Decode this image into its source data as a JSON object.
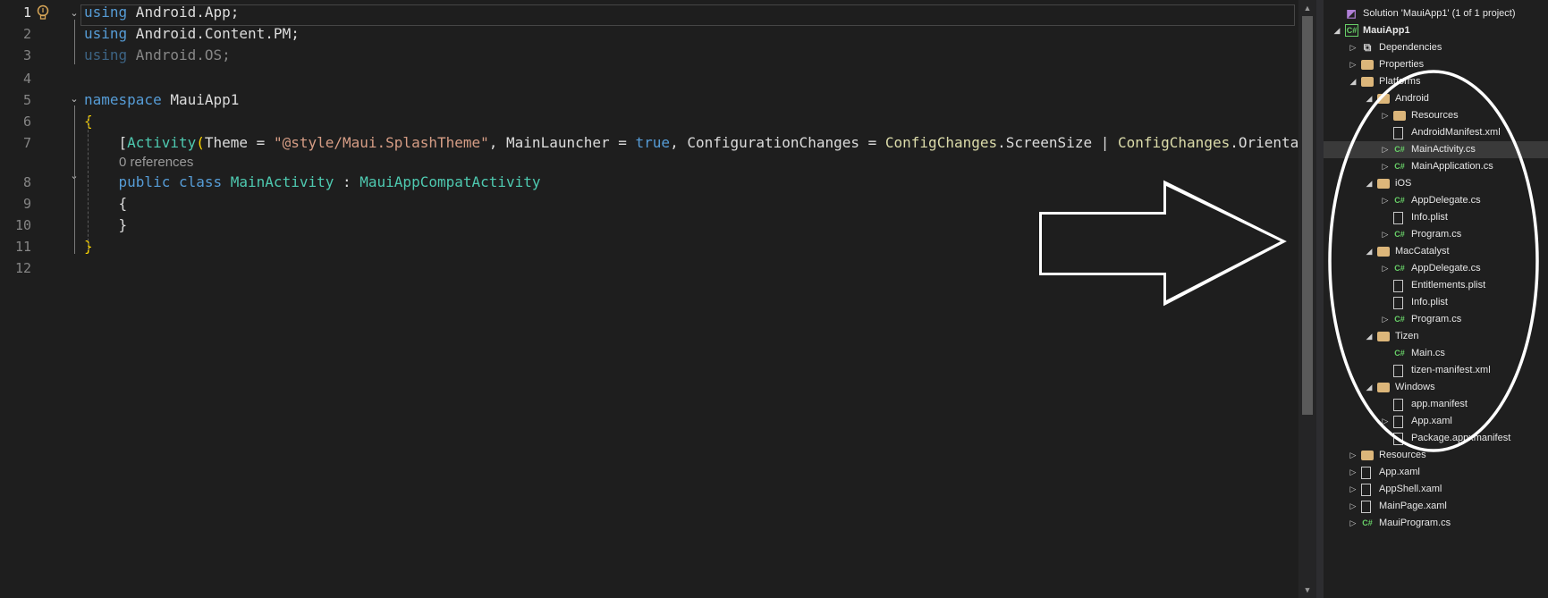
{
  "editor": {
    "lines": [
      {
        "n": "1",
        "active": true,
        "parts": [
          [
            "kw",
            "using"
          ],
          [
            "",
            " Android.App;"
          ]
        ]
      },
      {
        "n": "2",
        "parts": [
          [
            "kw",
            "using"
          ],
          [
            "",
            " Android.Content.PM;"
          ]
        ]
      },
      {
        "n": "3",
        "parts": [
          [
            "kw dim",
            "using"
          ],
          [
            "dim",
            " Android.OS;"
          ]
        ]
      },
      {
        "n": "4",
        "parts": []
      },
      {
        "n": "5",
        "parts": [
          [
            "kw",
            "namespace"
          ],
          [
            "",
            " MauiApp1"
          ]
        ]
      },
      {
        "n": "6",
        "parts": [
          [
            "brace",
            "{"
          ]
        ]
      },
      {
        "n": "7",
        "parts": [
          [
            "",
            "    ["
          ],
          [
            "attr",
            "Activity"
          ],
          [
            "brace",
            "("
          ],
          [
            "",
            "Theme = "
          ],
          [
            "str",
            "\"@style/Maui.SplashTheme\""
          ],
          [
            "",
            ", MainLauncher = "
          ],
          [
            "kw",
            "true"
          ],
          [
            "",
            ", ConfigurationChanges = "
          ],
          [
            "ns",
            "ConfigChanges"
          ],
          [
            "",
            ".ScreenSize | "
          ],
          [
            "ns",
            "ConfigChanges"
          ],
          [
            "",
            ".Orientation"
          ]
        ]
      },
      {
        "n": "8",
        "parts": [
          [
            "",
            "    "
          ],
          [
            "kw",
            "public class"
          ],
          [
            "",
            " "
          ],
          [
            "type",
            "MainActivity"
          ],
          [
            "",
            " : "
          ],
          [
            "type",
            "MauiAppCompatActivity"
          ]
        ]
      },
      {
        "n": "9",
        "parts": [
          [
            "",
            "    {"
          ]
        ]
      },
      {
        "n": "10",
        "parts": [
          [
            "",
            "    }"
          ]
        ]
      },
      {
        "n": "11",
        "parts": [
          [
            "brace",
            "}"
          ]
        ]
      },
      {
        "n": "12",
        "parts": []
      }
    ],
    "codelens": "0 references"
  },
  "solution_explorer": {
    "items": [
      {
        "label": "Solution 'MauiApp1' (1 of 1 project)",
        "icon": "solution-icon",
        "level": 0,
        "exp": ""
      },
      {
        "label": "MauiApp1",
        "icon": "csproj-icon",
        "level": 0,
        "exp": "open",
        "bold": true
      },
      {
        "label": "Dependencies",
        "icon": "dependencies-icon",
        "level": 1,
        "exp": "closed"
      },
      {
        "label": "Properties",
        "icon": "folder-icon",
        "level": 1,
        "exp": "closed"
      },
      {
        "label": "Platforms",
        "icon": "folder-icon",
        "level": 1,
        "exp": "open"
      },
      {
        "label": "Android",
        "icon": "folder-icon",
        "level": 2,
        "exp": "open"
      },
      {
        "label": "Resources",
        "icon": "folder-icon",
        "level": 3,
        "exp": "closed"
      },
      {
        "label": "AndroidManifest.xml",
        "icon": "xml-file-icon",
        "level": 3,
        "exp": ""
      },
      {
        "label": "MainActivity.cs",
        "icon": "csharp-file-icon",
        "level": 3,
        "exp": "closed",
        "selected": true
      },
      {
        "label": "MainApplication.cs",
        "icon": "csharp-file-icon",
        "level": 3,
        "exp": "closed"
      },
      {
        "label": "iOS",
        "icon": "folder-icon",
        "level": 2,
        "exp": "open"
      },
      {
        "label": "AppDelegate.cs",
        "icon": "csharp-file-icon",
        "level": 3,
        "exp": "closed"
      },
      {
        "label": "Info.plist",
        "icon": "file-icon",
        "level": 3,
        "exp": ""
      },
      {
        "label": "Program.cs",
        "icon": "csharp-file-icon",
        "level": 3,
        "exp": "closed"
      },
      {
        "label": "MacCatalyst",
        "icon": "folder-icon",
        "level": 2,
        "exp": "open"
      },
      {
        "label": "AppDelegate.cs",
        "icon": "csharp-file-icon",
        "level": 3,
        "exp": "closed"
      },
      {
        "label": "Entitlements.plist",
        "icon": "file-icon",
        "level": 3,
        "exp": ""
      },
      {
        "label": "Info.plist",
        "icon": "file-icon",
        "level": 3,
        "exp": ""
      },
      {
        "label": "Program.cs",
        "icon": "csharp-file-icon",
        "level": 3,
        "exp": "closed"
      },
      {
        "label": "Tizen",
        "icon": "folder-icon",
        "level": 2,
        "exp": "open"
      },
      {
        "label": "Main.cs",
        "icon": "csharp-file-icon",
        "level": 3,
        "exp": ""
      },
      {
        "label": "tizen-manifest.xml",
        "icon": "xml-file-icon",
        "level": 3,
        "exp": ""
      },
      {
        "label": "Windows",
        "icon": "folder-icon",
        "level": 2,
        "exp": "open"
      },
      {
        "label": "app.manifest",
        "icon": "manifest-file-icon",
        "level": 3,
        "exp": ""
      },
      {
        "label": "App.xaml",
        "icon": "xaml-file-icon",
        "level": 3,
        "exp": "closed"
      },
      {
        "label": "Package.appxmanifest",
        "icon": "manifest-file-icon",
        "level": 3,
        "exp": ""
      },
      {
        "label": "Resources",
        "icon": "folder-icon",
        "level": 1,
        "exp": "closed"
      },
      {
        "label": "App.xaml",
        "icon": "xaml-file-icon",
        "level": 1,
        "exp": "closed"
      },
      {
        "label": "AppShell.xaml",
        "icon": "xaml-file-icon",
        "level": 1,
        "exp": "closed"
      },
      {
        "label": "MainPage.xaml",
        "icon": "xaml-file-icon",
        "level": 1,
        "exp": "closed"
      },
      {
        "label": "MauiProgram.cs",
        "icon": "csharp-file-icon",
        "level": 1,
        "exp": "closed"
      }
    ]
  }
}
